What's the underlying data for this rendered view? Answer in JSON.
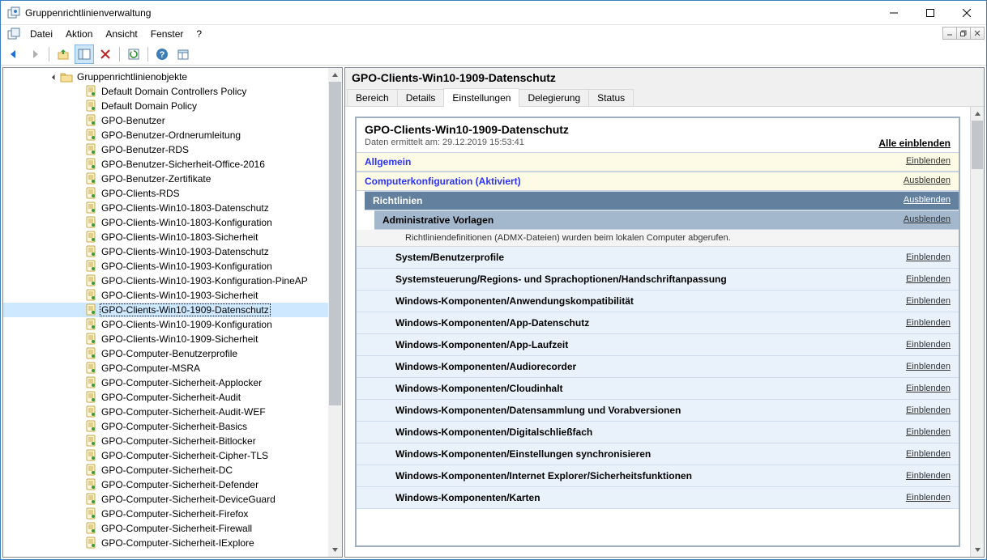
{
  "app": {
    "title": "Gruppenrichtlinienverwaltung"
  },
  "menu": {
    "file": "Datei",
    "action": "Aktion",
    "view": "Ansicht",
    "window": "Fenster",
    "help": "?"
  },
  "tree": {
    "folder": "Gruppenrichtlinienobjekte",
    "items": [
      "Default Domain Controllers Policy",
      "Default Domain Policy",
      "GPO-Benutzer",
      "GPO-Benutzer-Ordnerumleitung",
      "GPO-Benutzer-RDS",
      "GPO-Benutzer-Sicherheit-Office-2016",
      "GPO-Benutzer-Zertifikate",
      "GPO-Clients-RDS",
      "GPO-Clients-Win10-1803-Datenschutz",
      "GPO-Clients-Win10-1803-Konfiguration",
      "GPO-Clients-Win10-1803-Sicherheit",
      "GPO-Clients-Win10-1903-Datenschutz",
      "GPO-Clients-Win10-1903-Konfiguration",
      "GPO-Clients-Win10-1903-Konfiguration-PineAP",
      "GPO-Clients-Win10-1903-Sicherheit",
      "GPO-Clients-Win10-1909-Datenschutz",
      "GPO-Clients-Win10-1909-Konfiguration",
      "GPO-Clients-Win10-1909-Sicherheit",
      "GPO-Computer-Benutzerprofile",
      "GPO-Computer-MSRA",
      "GPO-Computer-Sicherheit-Applocker",
      "GPO-Computer-Sicherheit-Audit",
      "GPO-Computer-Sicherheit-Audit-WEF",
      "GPO-Computer-Sicherheit-Basics",
      "GPO-Computer-Sicherheit-Bitlocker",
      "GPO-Computer-Sicherheit-Cipher-TLS",
      "GPO-Computer-Sicherheit-DC",
      "GPO-Computer-Sicherheit-Defender",
      "GPO-Computer-Sicherheit-DeviceGuard",
      "GPO-Computer-Sicherheit-Firefox",
      "GPO-Computer-Sicherheit-Firewall",
      "GPO-Computer-Sicherheit-IExplore"
    ],
    "selected_index": 15
  },
  "content": {
    "header": "GPO-Clients-Win10-1909-Datenschutz",
    "tabs": [
      "Bereich",
      "Details",
      "Einstellungen",
      "Delegierung",
      "Status"
    ],
    "active_tab_index": 2,
    "report": {
      "title": "GPO-Clients-Win10-1909-Datenschutz",
      "collected": "Daten ermittelt am: 29.12.2019 15:53:41",
      "expand_all": "Alle einblenden",
      "expand": "Einblenden",
      "collapse": "Ausblenden",
      "sec_general": "Allgemein",
      "sec_computer": "Computerkonfiguration (Aktiviert)",
      "sec_policies": "Richtlinien",
      "sec_admin": "Administrative Vorlagen",
      "admx_note": "Richtliniendefinitionen (ADMX-Dateien) wurden beim lokalen Computer abgerufen.",
      "policies": [
        "System/Benutzerprofile",
        "Systemsteuerung/Regions- und Sprachoptionen/Handschriftanpassung",
        "Windows-Komponenten/Anwendungskompatibilität",
        "Windows-Komponenten/App-Datenschutz",
        "Windows-Komponenten/App-Laufzeit",
        "Windows-Komponenten/Audiorecorder",
        "Windows-Komponenten/Cloudinhalt",
        "Windows-Komponenten/Datensammlung und Vorabversionen",
        "Windows-Komponenten/Digitalschließfach",
        "Windows-Komponenten/Einstellungen synchronisieren",
        "Windows-Komponenten/Internet Explorer/Sicherheitsfunktionen",
        "Windows-Komponenten/Karten"
      ]
    }
  }
}
